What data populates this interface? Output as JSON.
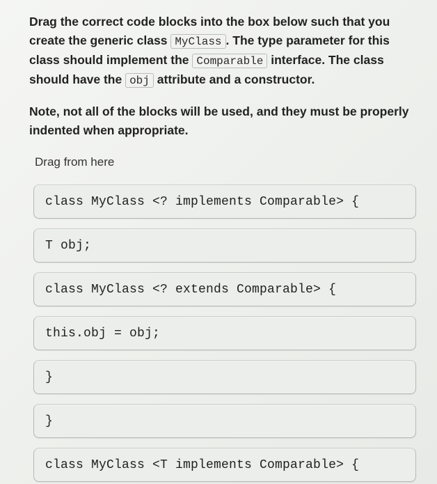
{
  "instructions": {
    "p1_a": "Drag the correct code blocks into the box below such that you create the generic class ",
    "code1": "MyClass",
    "p1_b": ". The type parameter for this class should implement the ",
    "code2": "Comparable",
    "p1_c": " interface. The class should have the ",
    "code3": "obj",
    "p1_d": " attribute and a constructor."
  },
  "note": "Note, not all of the blocks will be used, and they must be properly indented when appropriate.",
  "drag_label": "Drag from here",
  "blocks": [
    "class MyClass <? implements Comparable> {",
    "T obj;",
    "class MyClass <? extends Comparable> {",
    "this.obj = obj;",
    "}",
    "}",
    "class MyClass <T implements Comparable> {"
  ]
}
